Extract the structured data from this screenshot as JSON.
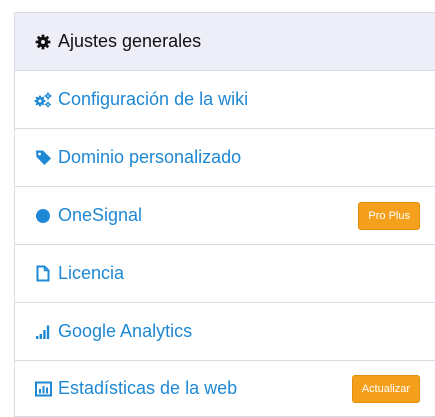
{
  "menu": {
    "items": [
      {
        "label": "Ajustes generales",
        "icon": "gear-icon"
      },
      {
        "label": "Configuración de la wiki",
        "icon": "gears-icon"
      },
      {
        "label": "Dominio personalizado",
        "icon": "tag-icon"
      },
      {
        "label": "OneSignal",
        "icon": "circle-icon",
        "badge": "Pro Plus"
      },
      {
        "label": "Licencia",
        "icon": "document-icon"
      },
      {
        "label": "Google Analytics",
        "icon": "signal-bars-icon"
      },
      {
        "label": "Estadísticas de la web",
        "icon": "bar-chart-icon",
        "badge": "Actualizar"
      }
    ]
  },
  "colors": {
    "link": "#1e88d4",
    "active_bg": "#eeeef8",
    "badge": "#f5a01d",
    "border": "#d9dde3"
  }
}
